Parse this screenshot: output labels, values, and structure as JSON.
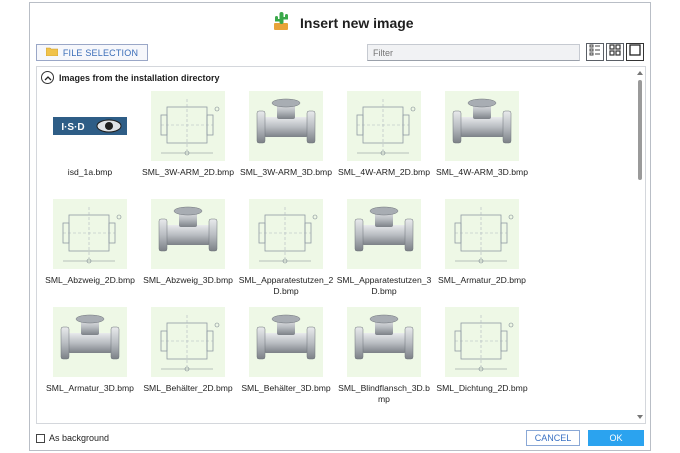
{
  "dialog": {
    "title": "Insert new image",
    "icon": "cactus-icon"
  },
  "toolbar": {
    "file_selection_label": "FILE SELECTION",
    "filter_placeholder": "Filter",
    "view_icons": [
      "list-view-icon",
      "grid-view-icon",
      "large-view-icon"
    ]
  },
  "section": {
    "title": "Images from the installation directory"
  },
  "images": [
    {
      "name": "isd_1a.bmp",
      "kind": "logo"
    },
    {
      "name": "SML_3W-ARM_2D.bmp",
      "kind": "drawing"
    },
    {
      "name": "SML_3W-ARM_3D.bmp",
      "kind": "model"
    },
    {
      "name": "SML_4W-ARM_2D.bmp",
      "kind": "drawing"
    },
    {
      "name": "SML_4W-ARM_3D.bmp",
      "kind": "model"
    },
    {
      "name": "SML_Abzweig_2D.bmp",
      "kind": "drawing"
    },
    {
      "name": "SML_Abzweig_3D.bmp",
      "kind": "model"
    },
    {
      "name": "SML_Apparatestutzen_2D.bmp",
      "kind": "drawing"
    },
    {
      "name": "SML_Apparatestutzen_3D.bmp",
      "kind": "model"
    },
    {
      "name": "SML_Armatur_2D.bmp",
      "kind": "drawing"
    },
    {
      "name": "SML_Armatur_3D.bmp",
      "kind": "model"
    },
    {
      "name": "SML_Behälter_2D.bmp",
      "kind": "drawing"
    },
    {
      "name": "SML_Behälter_3D.bmp",
      "kind": "model"
    },
    {
      "name": "SML_Blindflansch_3D.bmp",
      "kind": "model"
    },
    {
      "name": "SML_Dichtung_2D.bmp",
      "kind": "drawing"
    }
  ],
  "logo_text": "I·S·D",
  "footer": {
    "background_label": "As background",
    "background_checked": false,
    "cancel_label": "CANCEL",
    "ok_label": "OK"
  },
  "colors": {
    "accent": "#2ba3ef",
    "link": "#3b72c4",
    "thumb_bg": "#eef8e6"
  }
}
